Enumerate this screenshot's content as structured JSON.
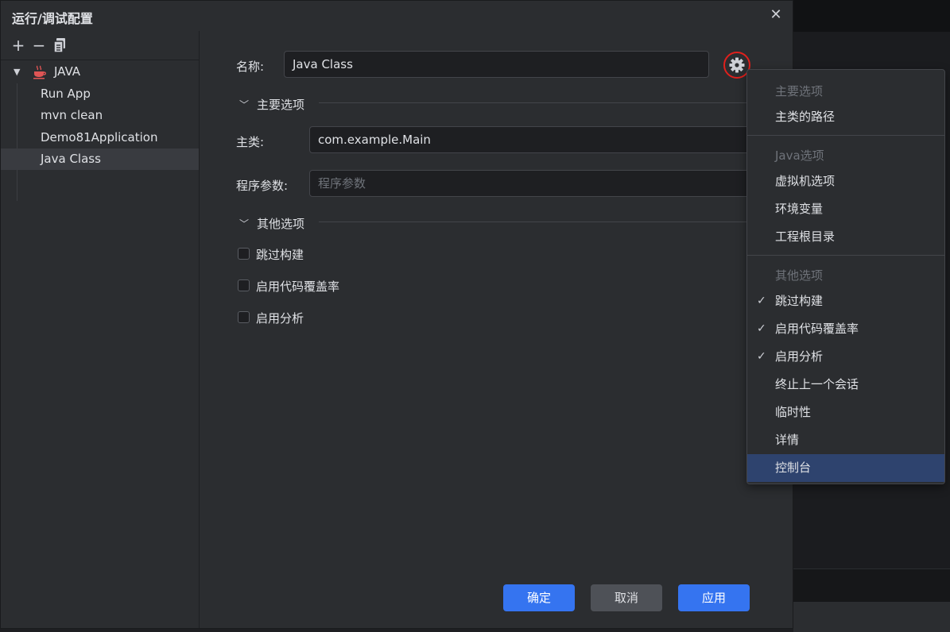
{
  "dialog": {
    "title": "运行/调试配置",
    "close": "✕"
  },
  "toolbar": {
    "add": "+",
    "remove": "−"
  },
  "tree": {
    "group": "JAVA",
    "items": [
      "Run App",
      "mvn clean",
      "Demo81Application",
      "Java Class"
    ],
    "selected": "Java Class"
  },
  "form": {
    "name_label": "名称:",
    "name_value": "Java Class",
    "main_section": "主要选项",
    "main_class_label": "主类:",
    "main_class_value": "com.example.Main",
    "args_label": "程序参数:",
    "args_placeholder": "程序参数",
    "other_section": "其他选项",
    "checkboxes": [
      "跳过构建",
      "启用代码覆盖率",
      "启用分析"
    ]
  },
  "buttons": {
    "ok": "确定",
    "cancel": "取消",
    "apply": "应用"
  },
  "menu": {
    "header_main": "主要选项",
    "item_main_path": "主类的路径",
    "header_java": "Java选项",
    "item_vm": "虚拟机选项",
    "item_env": "环境变量",
    "item_root": "工程根目录",
    "header_other": "其他选项",
    "item_skip_build": "跳过构建",
    "item_coverage": "启用代码覆盖率",
    "item_profile": "启用分析",
    "item_terminate": "终止上一个会话",
    "item_temp": "临时性",
    "item_detail": "详情",
    "item_console": "控制台",
    "checked": [
      "跳过构建",
      "启用代码覆盖率",
      "启用分析"
    ],
    "highlighted": "控制台"
  },
  "colors": {
    "accent": "#3574f0",
    "annotation": "#e0201c",
    "menu_highlight": "#2e436e"
  },
  "icons": [
    "plus-icon",
    "minus-icon",
    "copy-icon",
    "coffee-cup-icon",
    "expand-triangle-icon",
    "chevron-down-icon",
    "gear-icon",
    "check-icon",
    "close-icon"
  ]
}
